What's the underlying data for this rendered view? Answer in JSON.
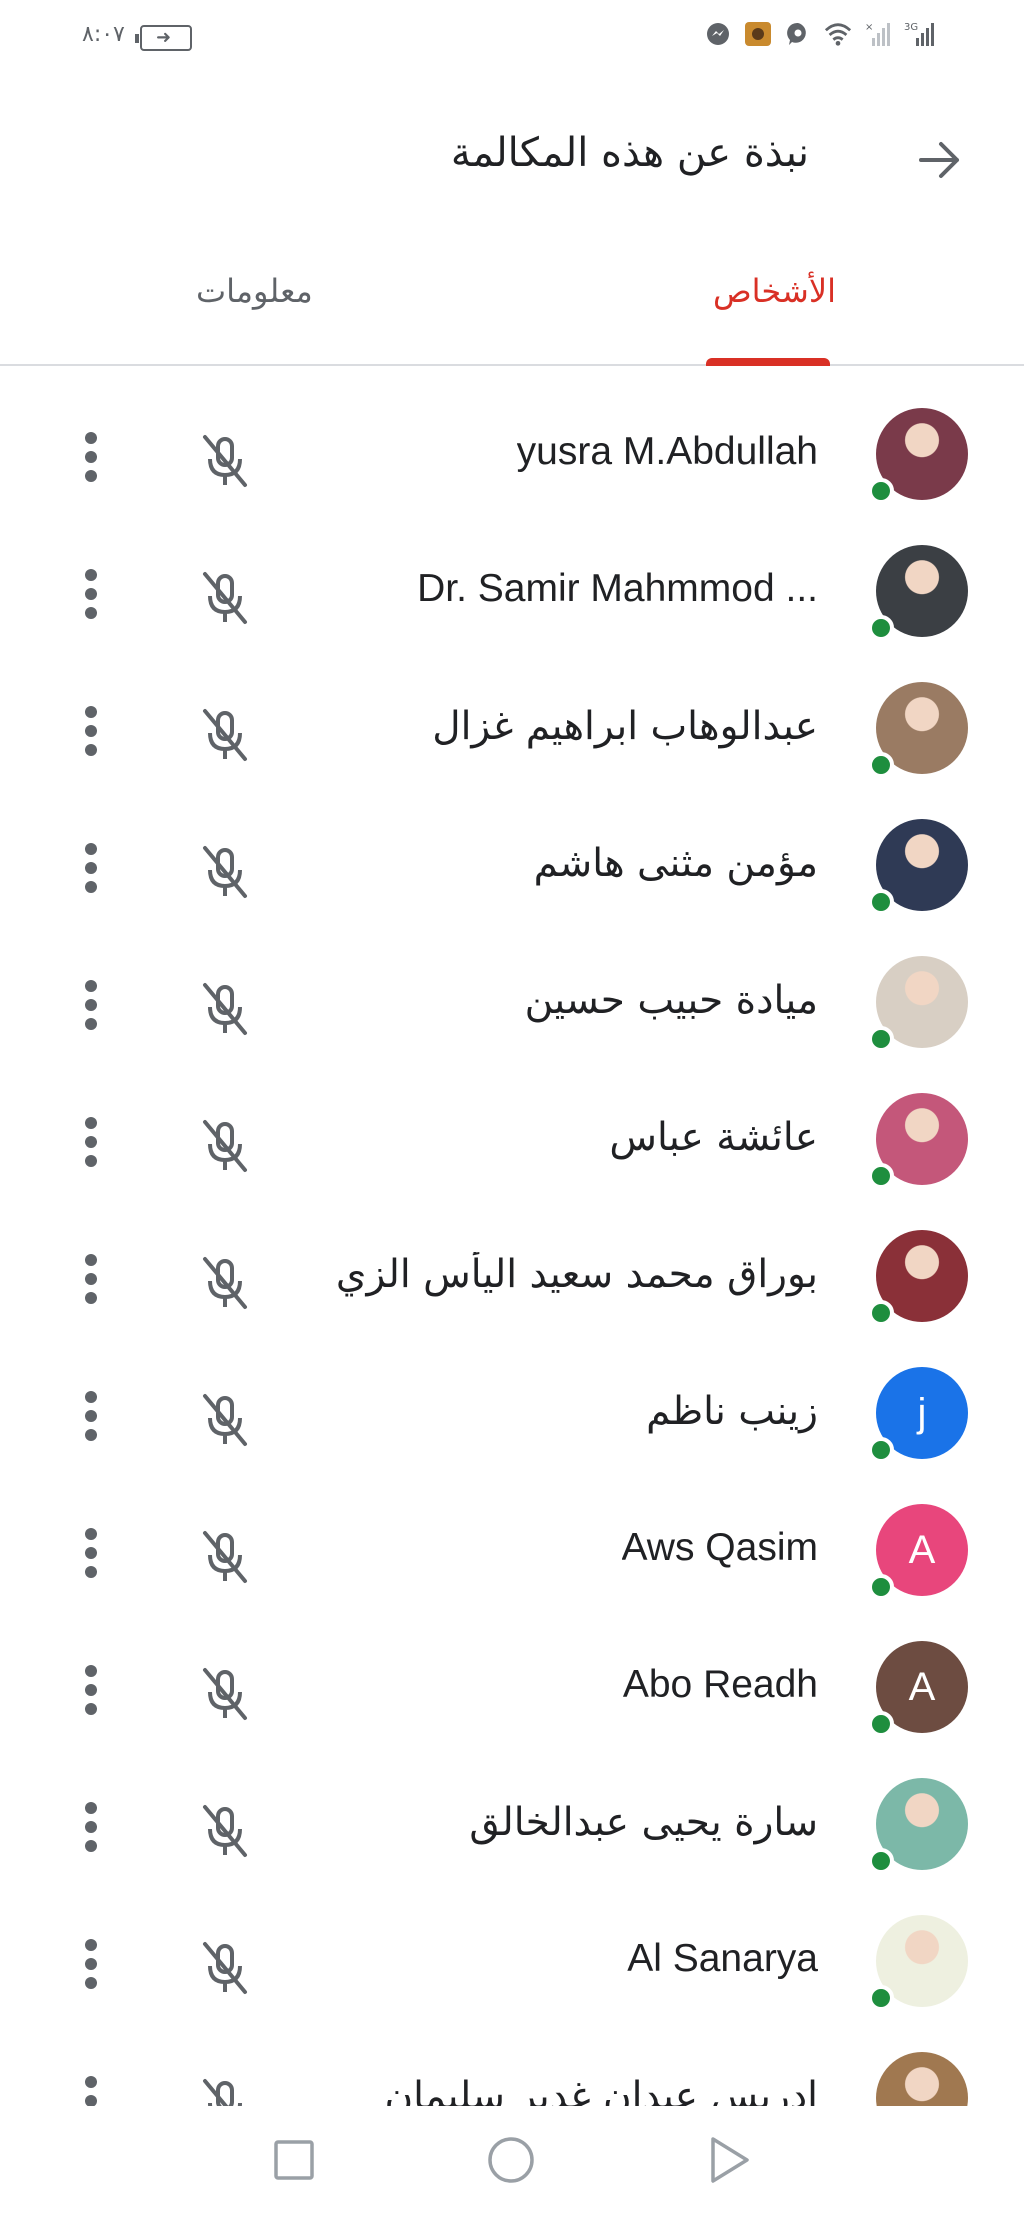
{
  "status_bar": {
    "time": "٨:٠٧",
    "network": "3G"
  },
  "header": {
    "title": "نبذة عن هذه المكالمة",
    "back_icon": "arrow-right-icon"
  },
  "tabs": [
    {
      "label": "الأشخاص",
      "active": true
    },
    {
      "label": "معلومات",
      "active": false
    }
  ],
  "colors": {
    "accent": "#d93025",
    "presence": "#1e8e3e",
    "icon_grey": "#5f6368"
  },
  "participants": [
    {
      "name": "yusra M.Abdullah",
      "avatar_type": "photo",
      "avatar_color": "#7a3a4a",
      "initial": "",
      "online": true,
      "muted": true
    },
    {
      "name": "Dr. Samir Mahmmod ...",
      "avatar_type": "photo",
      "avatar_color": "#3b3f44",
      "initial": "",
      "online": true,
      "muted": true
    },
    {
      "name": "عبدالوهاب ابراهيم غزال",
      "avatar_type": "photo",
      "avatar_color": "#9a7b63",
      "initial": "",
      "online": true,
      "muted": true
    },
    {
      "name": "مؤمن مثنى هاشم",
      "avatar_type": "photo",
      "avatar_color": "#2f3a55",
      "initial": "",
      "online": true,
      "muted": true
    },
    {
      "name": "ميادة حبيب حسين",
      "avatar_type": "photo",
      "avatar_color": "#d8cfc4",
      "initial": "",
      "online": true,
      "muted": true
    },
    {
      "name": "عائشة عباس",
      "avatar_type": "photo",
      "avatar_color": "#c4577a",
      "initial": "",
      "online": true,
      "muted": true
    },
    {
      "name": "بوراق محمد سعيد اليأس الزي...",
      "avatar_type": "photo",
      "avatar_color": "#8a3038",
      "initial": "",
      "online": true,
      "muted": true
    },
    {
      "name": "زينب ناظم",
      "avatar_type": "letter",
      "avatar_color": "#1a73e8",
      "initial": "j",
      "online": true,
      "muted": true
    },
    {
      "name": "Aws Qasim",
      "avatar_type": "letter",
      "avatar_color": "#e8467c",
      "initial": "A",
      "online": true,
      "muted": true
    },
    {
      "name": "Abo Readh",
      "avatar_type": "letter",
      "avatar_color": "#6d4c41",
      "initial": "A",
      "online": true,
      "muted": true
    },
    {
      "name": "سارة يحيى عبدالخالق",
      "avatar_type": "photo",
      "avatar_color": "#7cb8a8",
      "initial": "",
      "online": true,
      "muted": true
    },
    {
      "name": "Al Sanarya",
      "avatar_type": "photo",
      "avatar_color": "#eef0e0",
      "initial": "",
      "online": true,
      "muted": true
    },
    {
      "name": "ادريس عيدان غدير سليمان",
      "avatar_type": "photo",
      "avatar_color": "#a07850",
      "initial": "",
      "online": true,
      "muted": true
    }
  ]
}
